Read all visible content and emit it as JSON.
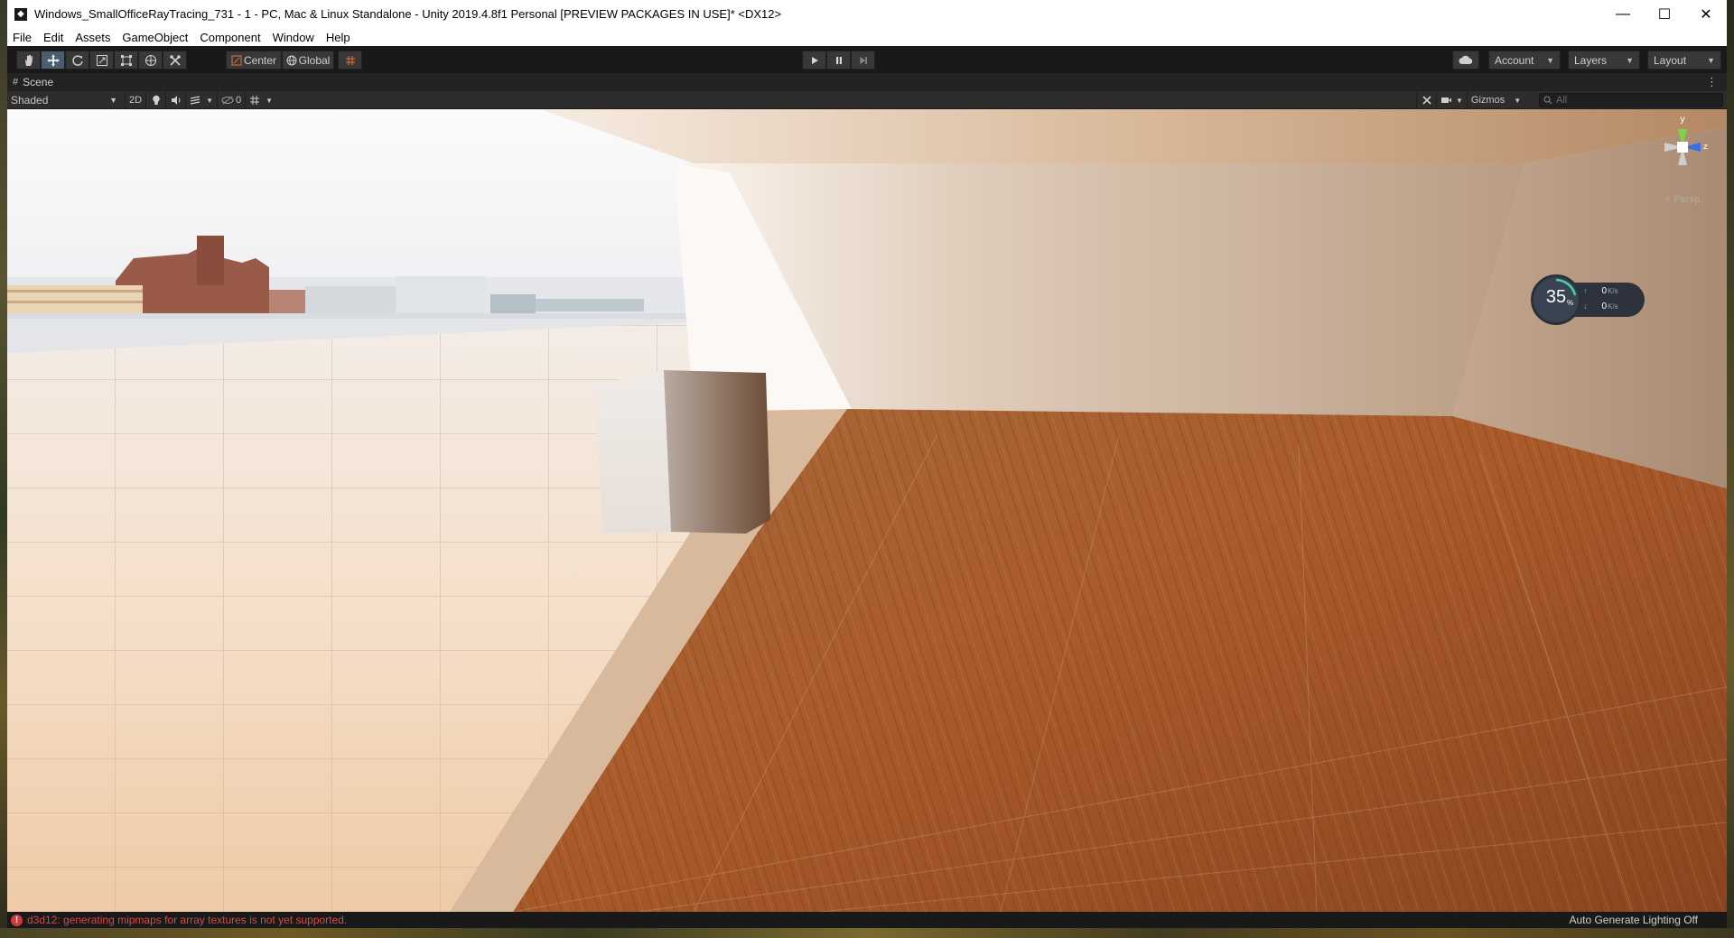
{
  "window": {
    "title": "Windows_SmallOfficeRayTracing_731 - 1 - PC, Mac & Linux Standalone - Unity 2019.4.8f1 Personal [PREVIEW PACKAGES IN USE]* <DX12>",
    "controls": {
      "minimize": "—",
      "maximize": "☐",
      "close": "✕"
    }
  },
  "menu": {
    "items": [
      "File",
      "Edit",
      "Assets",
      "GameObject",
      "Component",
      "Window",
      "Help"
    ]
  },
  "toolbar": {
    "tools": [
      "hand-icon",
      "move-icon",
      "rotate-icon",
      "scale-icon",
      "rect-icon",
      "transform-icon",
      "custom-tool-icon"
    ],
    "active_tool": "move-icon",
    "pivot_label": "Center",
    "space_label": "Global",
    "account_label": "Account",
    "layers_label": "Layers",
    "layout_label": "Layout"
  },
  "scene": {
    "tab_label": "Scene",
    "draw_mode": "Shaded",
    "two_d_label": "2D",
    "hidden_count": "0",
    "gizmos_label": "Gizmos",
    "search_placeholder": "All",
    "persp_label": "< Persp",
    "axis_y": "y",
    "axis_z": "z"
  },
  "perf_overlay": {
    "cpu_percent": "35",
    "percent_unit": "%",
    "upload": "0",
    "download": "0",
    "rate_unit": "K/s"
  },
  "status": {
    "error_message": "d3d12: generating mipmaps for array textures is not yet supported.",
    "right_text": "Auto Generate Lighting Off"
  },
  "colors": {
    "titlebar": "#ffffff",
    "toolbar": "#191919",
    "error": "#d64a46",
    "wood_dark": "#8a4520",
    "wood_light": "#f1dcc7"
  }
}
